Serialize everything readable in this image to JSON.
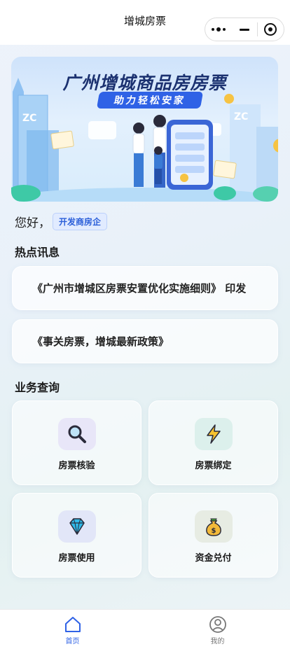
{
  "app": {
    "title": "增城房票"
  },
  "banner": {
    "title": "广州增城商品房房票",
    "subtitle": "助力轻松安家"
  },
  "greeting": {
    "hello": "您好，",
    "role": "开发商房企"
  },
  "news": {
    "heading": "热点讯息",
    "items": [
      "《广州市增城区房票安置优化实施细则》 印发",
      "《事关房票，增城最新政策》"
    ]
  },
  "services": {
    "heading": "业务查询",
    "items": [
      {
        "label": "房票核验",
        "icon": "magnifier-icon",
        "bg": "#e8e6f8"
      },
      {
        "label": "房票绑定",
        "icon": "lightning-icon",
        "bg": "#dcf0ec"
      },
      {
        "label": "房票使用",
        "icon": "diamond-icon",
        "bg": "#e2e6f8"
      },
      {
        "label": "资金兑付",
        "icon": "money-bag-icon",
        "bg": "#e7ece3"
      }
    ]
  },
  "tabbar": {
    "items": [
      {
        "label": "首页",
        "icon": "home-icon",
        "active": true
      },
      {
        "label": "我的",
        "icon": "user-icon",
        "active": false
      }
    ]
  },
  "colors": {
    "accent": "#2f62e6",
    "inactive": "#777777"
  }
}
